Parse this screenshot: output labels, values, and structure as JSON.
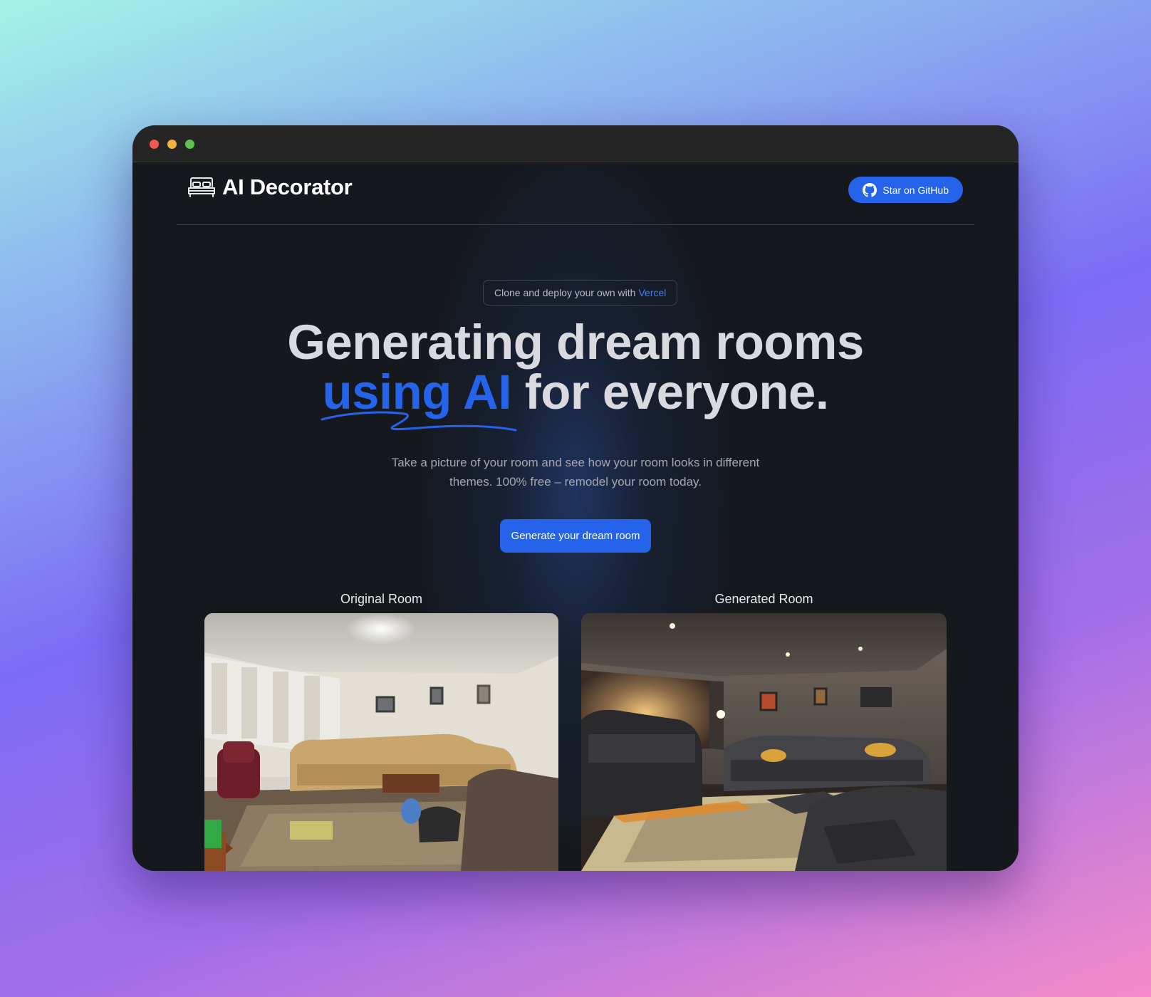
{
  "window": {
    "controls": [
      "close",
      "minimize",
      "zoom"
    ]
  },
  "header": {
    "brand_name": "AI Decorator",
    "brand_icon": "bed-icon",
    "github_button_label": "Star on GitHub",
    "github_icon": "github-icon"
  },
  "hero": {
    "pill_text": "Clone and deploy your own with",
    "pill_link": "Vercel",
    "headline_line1": "Generating dream rooms",
    "headline_accent": "using AI",
    "headline_rest": "for everyone.",
    "subtitle_line1": "Take a picture of your room and see how your room looks in different",
    "subtitle_line2": "themes. 100% free – remodel your room today.",
    "cta_label": "Generate your dream room"
  },
  "comparison": {
    "original_label": "Original Room",
    "generated_label": "Generated Room"
  },
  "colors": {
    "accent": "#2563eb",
    "page_background": "#15181d",
    "titlebar": "#252525"
  }
}
